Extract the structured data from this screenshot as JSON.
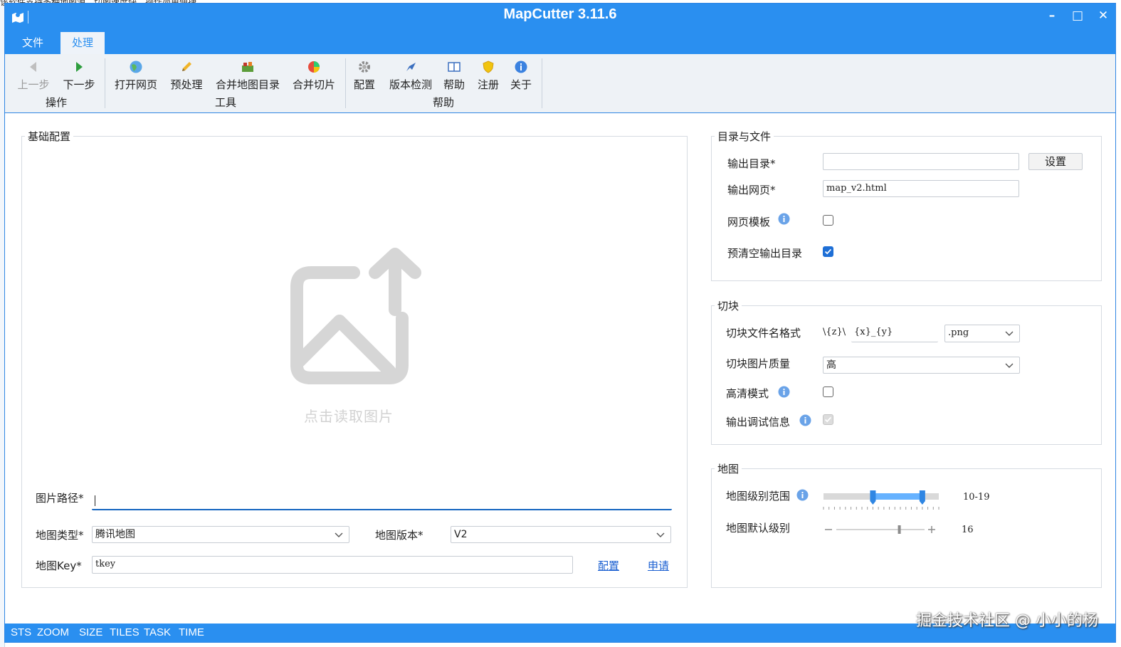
{
  "background": {
    "text": "该软件支持多种地图源，切图速度快，操作简单便捷"
  },
  "window": {
    "title": "MapCutter 3.11.6",
    "controls": {
      "minimize": "–",
      "maximize": "□",
      "close": "✕"
    }
  },
  "menu": {
    "tabs": [
      "文件",
      "处理"
    ],
    "active": "处理"
  },
  "ribbon": {
    "buttons": {
      "prev": "上一步",
      "next": "下一步",
      "open_web": "打开网页",
      "preprocess": "预处理",
      "merge_dir": "合并地图目录",
      "merge_tiles": "合并切片",
      "config": "配置",
      "version_check": "版本检测",
      "help": "帮助",
      "register": "注册",
      "about": "关于"
    },
    "groups": {
      "ops": "操作",
      "tools": "工具",
      "help": "帮助"
    }
  },
  "basic": {
    "legend": "基础配置",
    "drop_hint": "点击读取图片",
    "image_path_label": "图片路径*",
    "image_path_value": "",
    "map_type_label": "地图类型*",
    "map_type_value": "腾讯地图",
    "map_version_label": "地图版本*",
    "map_version_value": "V2",
    "map_key_label": "地图Key*",
    "map_key_value": "tkey",
    "config_link": "配置",
    "apply_link": "申请"
  },
  "dirs": {
    "legend": "目录与文件",
    "output_dir_label": "输出目录*",
    "output_dir_value": "",
    "set_button": "设置",
    "output_page_label": "输出网页*",
    "output_page_value": "map_v2.html",
    "template_label": "网页模板",
    "template_checked": false,
    "clear_label": "预清空输出目录",
    "clear_checked": true
  },
  "tile": {
    "legend": "切块",
    "name_format_label": "切块文件名格式",
    "name_prefix": "\\{z}\\",
    "name_value": "{x}_{y}",
    "ext_value": ".png",
    "quality_label": "切块图片质量",
    "quality_value": "高",
    "hd_label": "高清模式",
    "hd_checked": false,
    "debug_label": "输出调试信息",
    "debug_checked": false
  },
  "map": {
    "legend": "地图",
    "level_range_label": "地图级别范围",
    "level_range_value": "10-19",
    "level_range_min": 10,
    "level_range_max": 19,
    "default_level_label": "地图默认级别",
    "default_level_value": "16",
    "default_level": 16
  },
  "status": {
    "items": [
      "STS",
      "ZOOM",
      "SIZE",
      "TILES",
      "TASK",
      "TIME"
    ]
  },
  "watermark": "掘金技术社区 @ 小小的杨",
  "colors": {
    "accent": "#2a8ff0",
    "checkbox_checked": "#1e6fd6",
    "link": "#1a5fd1"
  }
}
